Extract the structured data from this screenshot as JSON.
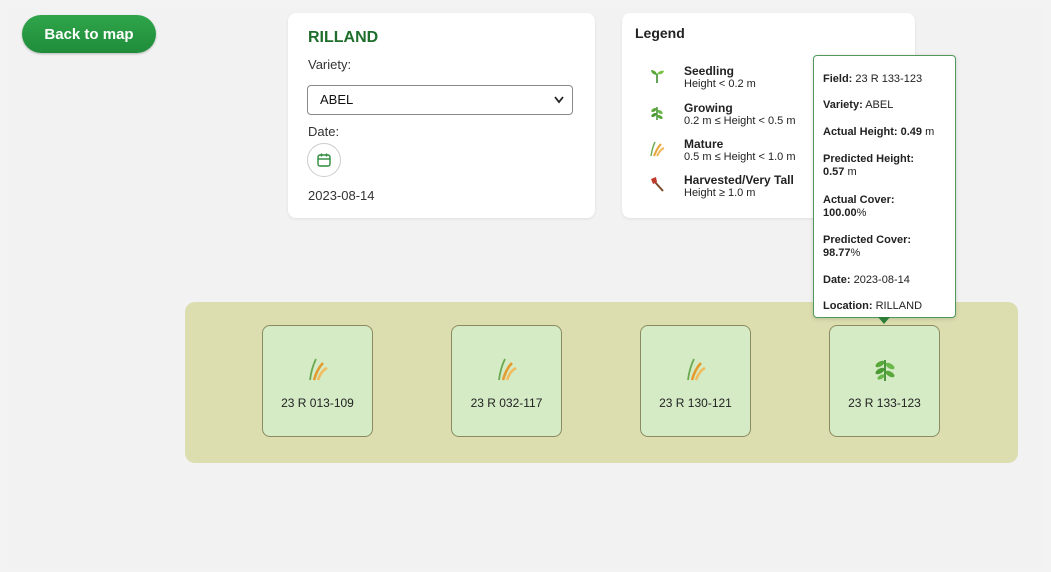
{
  "nav": {
    "back_label": "Back to map"
  },
  "info": {
    "location": "RILLAND",
    "variety_label": "Variety:",
    "variety_selected": "ABEL",
    "date_label": "Date:",
    "date_value": "2023-08-14"
  },
  "legend": {
    "title": "Legend",
    "items": [
      {
        "name": "Seedling",
        "range": "Height < 0.2 m",
        "icon": "seedling-icon"
      },
      {
        "name": "Growing",
        "range": "0.2 m ≤ Height < 0.5 m",
        "icon": "herb-icon"
      },
      {
        "name": "Mature",
        "range": "0.5 m ≤ Height < 1.0 m",
        "icon": "grain-icon"
      },
      {
        "name": "Harvested/Very Tall",
        "range": "Height ≥ 1.0 m",
        "icon": "axe-icon"
      }
    ]
  },
  "fields": [
    {
      "name": "23 R 013-109",
      "icon": "grain-icon"
    },
    {
      "name": "23 R 032-117",
      "icon": "grain-icon"
    },
    {
      "name": "23 R 130-121",
      "icon": "grain-icon"
    },
    {
      "name": "23 R 133-123",
      "icon": "herb-icon"
    }
  ],
  "tooltip": {
    "field_label": "Field:",
    "field_value": "23 R 133-123",
    "variety_label": "Variety:",
    "variety_value": "ABEL",
    "actual_height_label": "Actual Height:",
    "actual_height_value": "0.49",
    "actual_height_unit": "m",
    "predicted_height_label": "Predicted Height:",
    "predicted_height_value": "0.57",
    "predicted_height_unit": "m",
    "actual_cover_label": "Actual Cover:",
    "actual_cover_value": "100.00",
    "actual_cover_unit": "%",
    "predicted_cover_label": "Predicted Cover:",
    "predicted_cover_value": "98.77",
    "predicted_cover_unit": "%",
    "date_label": "Date:",
    "date_value": "2023-08-14",
    "location_label": "Location:",
    "location_value": "RILLAND"
  },
  "colors": {
    "accent": "#1f8c3a",
    "title_green": "#1f6e2c",
    "strip": "#dcdeb0",
    "tile": "#d4ebc6"
  }
}
